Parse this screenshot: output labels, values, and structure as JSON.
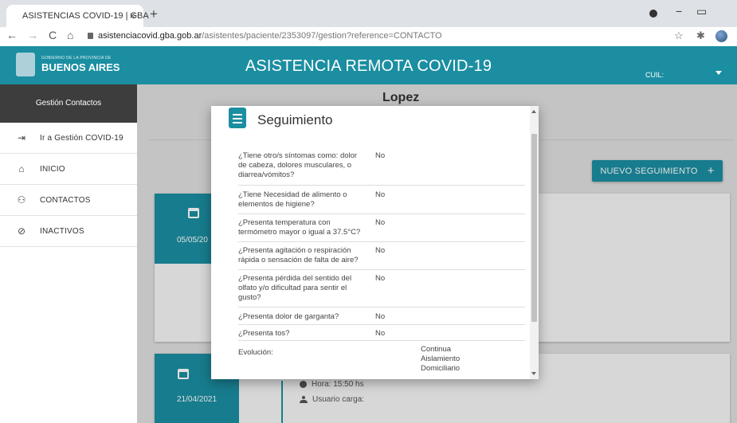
{
  "browser": {
    "tab_title": "ASISTENCIAS COVID-19 | GBA",
    "tab_close": "×",
    "new_tab": "+",
    "url_host": "asistenciacovid.gba.gob.ar",
    "url_path": "/asistentes/paciente/2353097/gestion?reference=CONTACTO",
    "back": "←",
    "forward": "→",
    "reload": "C",
    "home": "⌂",
    "star": "☆",
    "extension": "✱",
    "minimize": "−",
    "restore": "▭"
  },
  "header": {
    "logo_small": "GOBIERNO DE LA PROVINCIA DE",
    "logo_big": "BUENOS AIRES",
    "title": "ASISTENCIA REMOTA COVID-19",
    "cuil_label": "CUIL:"
  },
  "sidebar": {
    "header": "Gestión Contactos",
    "items": [
      {
        "label": "Ir a Gestión COVID-19",
        "icon": "⇥"
      },
      {
        "label": "INICIO",
        "icon": "⌂"
      },
      {
        "label": "CONTACTOS",
        "icon": "⚇"
      },
      {
        "label": "INACTIVOS",
        "icon": "⊘"
      }
    ]
  },
  "main": {
    "patient_name": "Lopez",
    "new_button": "NUEVO SEGUIMIENTO",
    "new_button_icon": "+",
    "cards": [
      {
        "date": "05/05/20"
      },
      {
        "date": "21/04/2021",
        "hora": "Hora: 15:50 hs",
        "usuario": "Usuario carga:"
      }
    ]
  },
  "modal": {
    "title": "Seguimiento",
    "questions": [
      {
        "q": "¿Tiene otro/s síntomas como: dolor de cabeza, dolores musculares, o diarrea/vómitos?",
        "a": "No"
      },
      {
        "q": "¿Tiene Necesidad de alimento o elementos de higiene?",
        "a": "No"
      },
      {
        "q": "¿Presenta temperatura con termómetro mayor o igual a 37.5°C?",
        "a": "No"
      },
      {
        "q": "¿Presenta agitación o respiración rápida o sensación de falta de aire?",
        "a": "No"
      },
      {
        "q": "¿Presenta pérdida del sentido del olfato y/o dificultad para sentir el gusto?",
        "a": "No"
      },
      {
        "q": "¿Presenta dolor de garganta?",
        "a": "No"
      },
      {
        "q": "¿Presenta tos?",
        "a": "No"
      }
    ],
    "evolucion_label": "Evolución:",
    "evolucion_value": "Continua Aislamiento Domiciliario"
  },
  "colors": {
    "primary": "#1b8ea1",
    "sidebar_header": "#3d3d3d"
  }
}
